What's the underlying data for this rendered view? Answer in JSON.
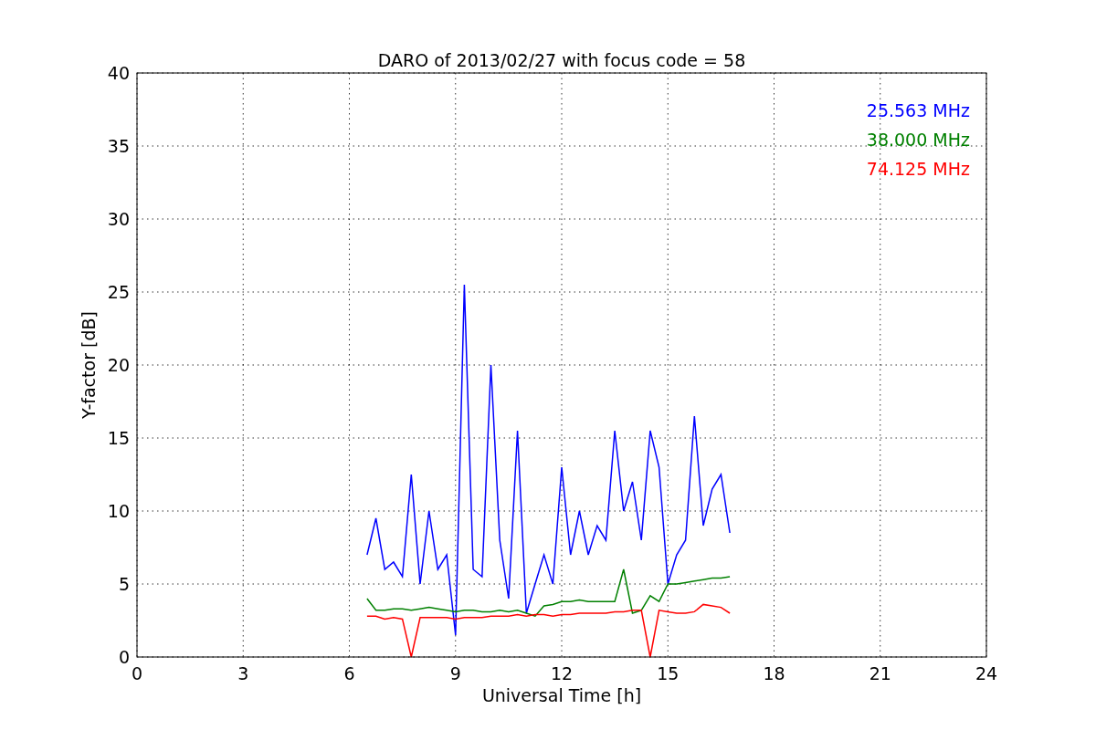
{
  "chart_data": {
    "type": "line",
    "title": "DARO of 2013/02/27 with focus code = 58",
    "xlabel": "Universal Time [h]",
    "ylabel": "Y-factor [dB]",
    "x": [
      6.5,
      6.75,
      7,
      7.25,
      7.5,
      7.75,
      8,
      8.25,
      8.5,
      8.75,
      9,
      9.25,
      9.5,
      9.75,
      10,
      10.25,
      10.5,
      10.75,
      11,
      11.25,
      11.5,
      11.75,
      12,
      12.25,
      12.5,
      12.75,
      13,
      13.25,
      13.5,
      13.75,
      14,
      14.25,
      14.5,
      14.75,
      15,
      15.25,
      15.5,
      15.75,
      16,
      16.25,
      16.5,
      16.75
    ],
    "series": [
      {
        "name": "25.563 MHz",
        "color": "#0000ff",
        "values": [
          7,
          9.5,
          6,
          6.5,
          5.5,
          12.5,
          5,
          10,
          6,
          7,
          1.5,
          25.5,
          6,
          5.5,
          20,
          8,
          4,
          15.5,
          3,
          5,
          7,
          5,
          13,
          7,
          10,
          7,
          9,
          8,
          15.5,
          10,
          12,
          8,
          15.5,
          13,
          5,
          7,
          8,
          16.5,
          9,
          11.5,
          12.5,
          8.5
        ]
      },
      {
        "name": "38.000 MHz",
        "color": "#008000",
        "values": [
          4,
          3.2,
          3.2,
          3.3,
          3.3,
          3.2,
          3.3,
          3.4,
          3.3,
          3.2,
          3.1,
          3.2,
          3.2,
          3.1,
          3.1,
          3.2,
          3.1,
          3.2,
          3,
          2.8,
          3.5,
          3.6,
          3.8,
          3.8,
          3.9,
          3.8,
          3.8,
          3.8,
          3.8,
          6,
          3,
          3.2,
          4.2,
          3.8,
          5,
          5,
          5.1,
          5.2,
          5.3,
          5.4,
          5.4,
          5.5
        ]
      },
      {
        "name": "74.125 MHz",
        "color": "#ff0000",
        "values": [
          2.8,
          2.8,
          2.6,
          2.7,
          2.6,
          0,
          2.7,
          2.7,
          2.7,
          2.7,
          2.6,
          2.7,
          2.7,
          2.7,
          2.8,
          2.8,
          2.8,
          2.9,
          2.8,
          2.9,
          2.9,
          2.8,
          2.9,
          2.9,
          3,
          3,
          3,
          3,
          3.1,
          3.1,
          3.2,
          3.2,
          0,
          3.2,
          3.1,
          3,
          3,
          3.1,
          3.6,
          3.5,
          3.4,
          3
        ]
      }
    ],
    "grid": true,
    "xlim": [
      0,
      24
    ],
    "ylim": [
      0,
      40
    ],
    "xticks": [
      0,
      3,
      6,
      9,
      12,
      15,
      18,
      21,
      24
    ],
    "yticks": [
      0,
      5,
      10,
      15,
      20,
      25,
      30,
      35,
      40
    ]
  }
}
